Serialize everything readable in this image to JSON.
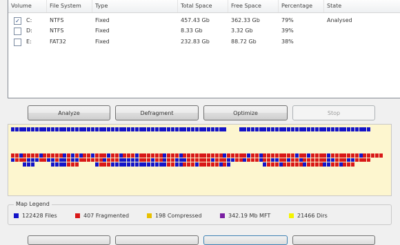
{
  "columns": [
    "Volume",
    "File System",
    "Type",
    "Total Space",
    "Free Space",
    "Percentage",
    "State"
  ],
  "volumes": [
    {
      "checked": true,
      "check_glyph": "✓",
      "volume": "C:",
      "fs": "NTFS",
      "type": "Fixed",
      "total": "457.43 Gb",
      "free": "362.33 Gb",
      "pct": "79%",
      "state": "Analysed"
    },
    {
      "checked": false,
      "check_glyph": "",
      "volume": "D:",
      "fs": "NTFS",
      "type": "Fixed",
      "total": "8.33 Gb",
      "free": "3.32 Gb",
      "pct": "39%",
      "state": ""
    },
    {
      "checked": false,
      "check_glyph": "",
      "volume": "E:",
      "fs": "FAT32",
      "type": "Fixed",
      "total": "232.83 Gb",
      "free": "88.72 Gb",
      "pct": "38%",
      "state": ""
    }
  ],
  "buttons": {
    "analyze": "Analyze",
    "defragment": "Defragment",
    "optimize": "Optimize",
    "stop": "Stop"
  },
  "legend": {
    "title": "Map Legend",
    "items": [
      {
        "label": "122428 Files",
        "color": "#1414c8"
      },
      {
        "label": "407 Fragmented",
        "color": "#d81818"
      },
      {
        "label": "198 Compressed",
        "color": "#e8c000"
      },
      {
        "label": "342.19 Mb MFT",
        "color": "#7a1fa2"
      },
      {
        "label": "21466 Dirs",
        "color": "#f4f400"
      }
    ]
  },
  "map": {
    "background": "#fdf6cf",
    "free_color": "#fdf6cf",
    "rows": [
      "BBBBBBBBBBBBBBBBBBBBBBBBBBBBBBBBBBBBBBBBBBBBBBBBBBBBBB...BBBBBBBBBBBBBBBBBBBBBBBBBBBBBBBBB",
      "",
      "",
      "",
      "",
      "",
      "RRBRRRRBRRRRRBRBRBRRBRRRBRRBRRRBRRRRRRBRRRBRRRRRRRRRRBRRRRRBRRBRRRRRRRRBRRBRRRRBRRRRRRRBRRRRR",
      "BRRRBBBRRBBRBBRBBRRRRRRBRRRBBBBBRRRBRRBRRBBBRRRRRRBRRRBBRRBRRRBRRBBRRBRRBRRRRRRBBRRRBBRRRR",
      "...BBB....BBBBRRR....BRRRBBBBBBBBBBBBBBRRBBRRRBRRRRRBRB........BRRRBRRRRRBRRRRBBRRBRRR.."
    ]
  }
}
